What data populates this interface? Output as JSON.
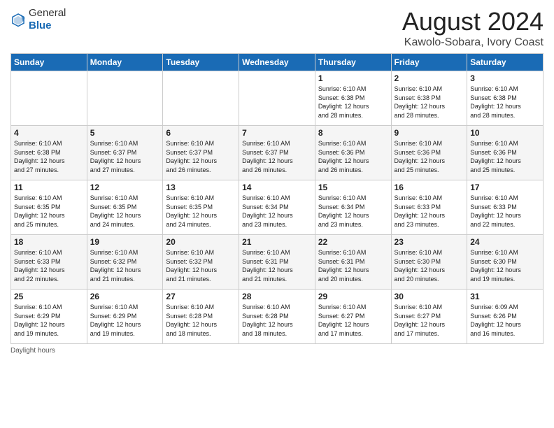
{
  "header": {
    "logo_general": "General",
    "logo_blue": "Blue",
    "month_title": "August 2024",
    "location": "Kawolo-Sobara, Ivory Coast"
  },
  "days_of_week": [
    "Sunday",
    "Monday",
    "Tuesday",
    "Wednesday",
    "Thursday",
    "Friday",
    "Saturday"
  ],
  "footer": "Daylight hours",
  "weeks": [
    [
      {
        "num": "",
        "info": ""
      },
      {
        "num": "",
        "info": ""
      },
      {
        "num": "",
        "info": ""
      },
      {
        "num": "",
        "info": ""
      },
      {
        "num": "1",
        "info": "Sunrise: 6:10 AM\nSunset: 6:38 PM\nDaylight: 12 hours\nand 28 minutes."
      },
      {
        "num": "2",
        "info": "Sunrise: 6:10 AM\nSunset: 6:38 PM\nDaylight: 12 hours\nand 28 minutes."
      },
      {
        "num": "3",
        "info": "Sunrise: 6:10 AM\nSunset: 6:38 PM\nDaylight: 12 hours\nand 28 minutes."
      }
    ],
    [
      {
        "num": "4",
        "info": "Sunrise: 6:10 AM\nSunset: 6:38 PM\nDaylight: 12 hours\nand 27 minutes."
      },
      {
        "num": "5",
        "info": "Sunrise: 6:10 AM\nSunset: 6:37 PM\nDaylight: 12 hours\nand 27 minutes."
      },
      {
        "num": "6",
        "info": "Sunrise: 6:10 AM\nSunset: 6:37 PM\nDaylight: 12 hours\nand 26 minutes."
      },
      {
        "num": "7",
        "info": "Sunrise: 6:10 AM\nSunset: 6:37 PM\nDaylight: 12 hours\nand 26 minutes."
      },
      {
        "num": "8",
        "info": "Sunrise: 6:10 AM\nSunset: 6:36 PM\nDaylight: 12 hours\nand 26 minutes."
      },
      {
        "num": "9",
        "info": "Sunrise: 6:10 AM\nSunset: 6:36 PM\nDaylight: 12 hours\nand 25 minutes."
      },
      {
        "num": "10",
        "info": "Sunrise: 6:10 AM\nSunset: 6:36 PM\nDaylight: 12 hours\nand 25 minutes."
      }
    ],
    [
      {
        "num": "11",
        "info": "Sunrise: 6:10 AM\nSunset: 6:35 PM\nDaylight: 12 hours\nand 25 minutes."
      },
      {
        "num": "12",
        "info": "Sunrise: 6:10 AM\nSunset: 6:35 PM\nDaylight: 12 hours\nand 24 minutes."
      },
      {
        "num": "13",
        "info": "Sunrise: 6:10 AM\nSunset: 6:35 PM\nDaylight: 12 hours\nand 24 minutes."
      },
      {
        "num": "14",
        "info": "Sunrise: 6:10 AM\nSunset: 6:34 PM\nDaylight: 12 hours\nand 23 minutes."
      },
      {
        "num": "15",
        "info": "Sunrise: 6:10 AM\nSunset: 6:34 PM\nDaylight: 12 hours\nand 23 minutes."
      },
      {
        "num": "16",
        "info": "Sunrise: 6:10 AM\nSunset: 6:33 PM\nDaylight: 12 hours\nand 23 minutes."
      },
      {
        "num": "17",
        "info": "Sunrise: 6:10 AM\nSunset: 6:33 PM\nDaylight: 12 hours\nand 22 minutes."
      }
    ],
    [
      {
        "num": "18",
        "info": "Sunrise: 6:10 AM\nSunset: 6:33 PM\nDaylight: 12 hours\nand 22 minutes."
      },
      {
        "num": "19",
        "info": "Sunrise: 6:10 AM\nSunset: 6:32 PM\nDaylight: 12 hours\nand 21 minutes."
      },
      {
        "num": "20",
        "info": "Sunrise: 6:10 AM\nSunset: 6:32 PM\nDaylight: 12 hours\nand 21 minutes."
      },
      {
        "num": "21",
        "info": "Sunrise: 6:10 AM\nSunset: 6:31 PM\nDaylight: 12 hours\nand 21 minutes."
      },
      {
        "num": "22",
        "info": "Sunrise: 6:10 AM\nSunset: 6:31 PM\nDaylight: 12 hours\nand 20 minutes."
      },
      {
        "num": "23",
        "info": "Sunrise: 6:10 AM\nSunset: 6:30 PM\nDaylight: 12 hours\nand 20 minutes."
      },
      {
        "num": "24",
        "info": "Sunrise: 6:10 AM\nSunset: 6:30 PM\nDaylight: 12 hours\nand 19 minutes."
      }
    ],
    [
      {
        "num": "25",
        "info": "Sunrise: 6:10 AM\nSunset: 6:29 PM\nDaylight: 12 hours\nand 19 minutes."
      },
      {
        "num": "26",
        "info": "Sunrise: 6:10 AM\nSunset: 6:29 PM\nDaylight: 12 hours\nand 19 minutes."
      },
      {
        "num": "27",
        "info": "Sunrise: 6:10 AM\nSunset: 6:28 PM\nDaylight: 12 hours\nand 18 minutes."
      },
      {
        "num": "28",
        "info": "Sunrise: 6:10 AM\nSunset: 6:28 PM\nDaylight: 12 hours\nand 18 minutes."
      },
      {
        "num": "29",
        "info": "Sunrise: 6:10 AM\nSunset: 6:27 PM\nDaylight: 12 hours\nand 17 minutes."
      },
      {
        "num": "30",
        "info": "Sunrise: 6:10 AM\nSunset: 6:27 PM\nDaylight: 12 hours\nand 17 minutes."
      },
      {
        "num": "31",
        "info": "Sunrise: 6:09 AM\nSunset: 6:26 PM\nDaylight: 12 hours\nand 16 minutes."
      }
    ]
  ]
}
